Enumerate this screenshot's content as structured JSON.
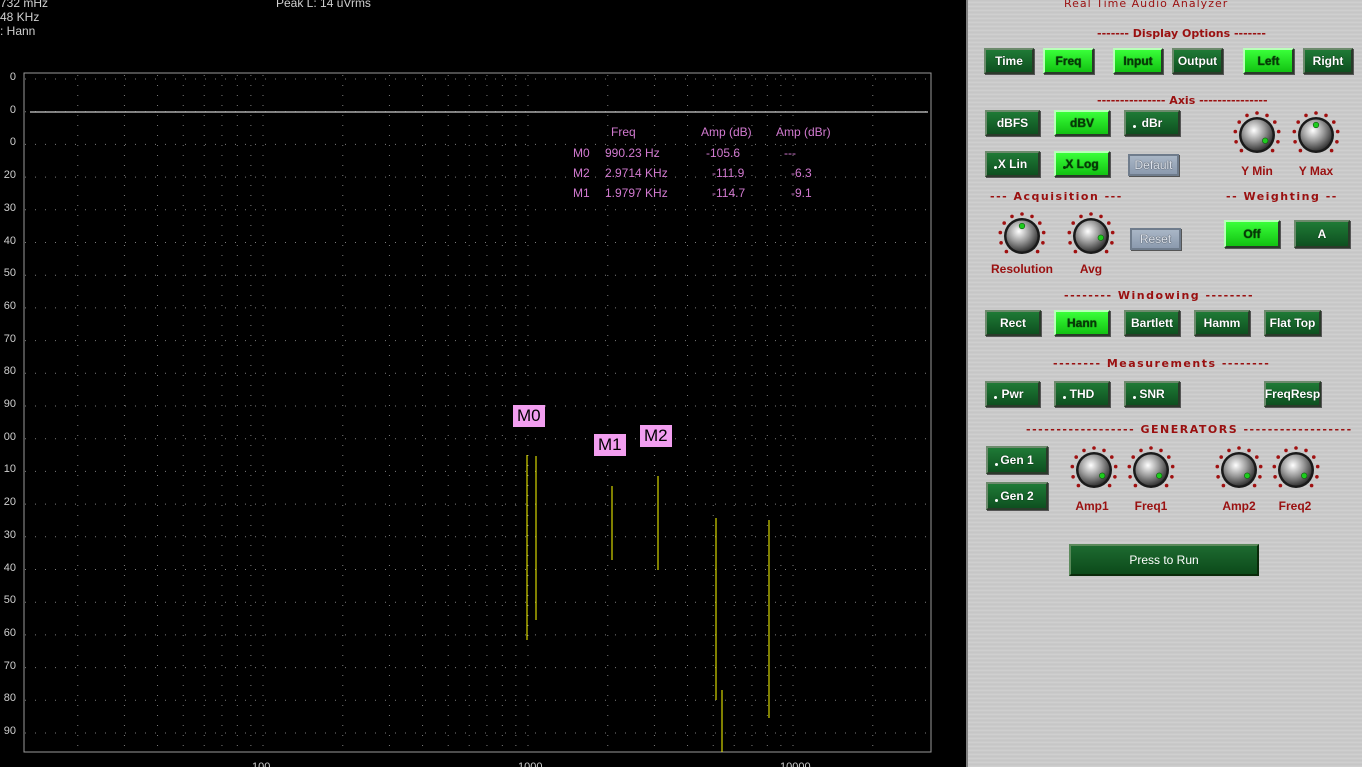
{
  "header": {
    "line1": "732 mHz",
    "line2": "48 KHz",
    "line3": ": Hann",
    "peak": "Peak L: 14 uVrms"
  },
  "y_axis_labels": [
    "0",
    "0",
    "0",
    "20",
    "30",
    "40",
    "50",
    "60",
    "70",
    "80",
    "90",
    "00",
    "10",
    "20",
    "30",
    "40",
    "50",
    "60",
    "70",
    "80",
    "90"
  ],
  "x_axis_labels": [
    "100",
    "1000",
    "10000"
  ],
  "markers_table": {
    "headers": [
      "Freq",
      "Amp (dB)",
      "Amp (dBr)"
    ],
    "rows": [
      {
        "name": "M0",
        "freq": "990.23 Hz",
        "amp": "-105.6",
        "ampr": "---"
      },
      {
        "name": "M2",
        "freq": "2.9714 KHz",
        "amp": "-111.9",
        "ampr": "-6.3"
      },
      {
        "name": "M1",
        "freq": "1.9797 KHz",
        "amp": "-114.7",
        "ampr": "-9.1"
      }
    ]
  },
  "marker_labels": {
    "m0": "M0",
    "m1": "M1",
    "m2": "M2"
  },
  "panel": {
    "title": "Real Time Audio Analyzer",
    "display_options": {
      "label": "------- Display Options -------",
      "buttons": [
        "Time",
        "Freq",
        "Input",
        "Output",
        "Left",
        "Right"
      ]
    },
    "axis": {
      "label": "--------------- Axis ---------------",
      "buttons": [
        "dBFS",
        "dBV",
        "dBr",
        "X Lin",
        "X Log",
        "Default"
      ],
      "knobs": [
        "Y Min",
        "Y Max"
      ]
    },
    "acquisition": {
      "label": "--- Acquisition ---",
      "knobs": [
        "Resolution",
        "Avg"
      ],
      "reset": "Reset"
    },
    "weighting": {
      "label": "-- Weighting --",
      "buttons": [
        "Off",
        "A"
      ]
    },
    "windowing": {
      "label": "-------- Windowing --------",
      "buttons": [
        "Rect",
        "Hann",
        "Bartlett",
        "Hamm",
        "Flat Top"
      ]
    },
    "measurements": {
      "label": "-------- Measurements --------",
      "buttons": [
        "Pwr",
        "THD",
        "SNR",
        "FreqResp"
      ]
    },
    "generators": {
      "label": "------------------ GENERATORS ------------------",
      "buttons": [
        "Gen 1",
        "Gen 2"
      ],
      "knobs": [
        "Amp1",
        "Freq1",
        "Amp2",
        "Freq2"
      ]
    },
    "run": "Press to Run"
  },
  "colors": {
    "trace": "#ffff00",
    "grid": "#7a7a7a",
    "marker_text": "#d27ad0",
    "marker_box": "#f29ef0",
    "active_btn": "#33ee33",
    "btn": "#147a2e",
    "section_text": "#9a1010"
  }
}
